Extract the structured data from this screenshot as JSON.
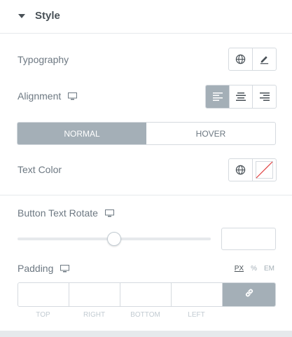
{
  "section": {
    "title": "Style",
    "toggle_icon": "caret-down-icon"
  },
  "typography": {
    "label": "Typography",
    "global_icon": "globe-icon",
    "edit_icon": "pencil-icon"
  },
  "alignment": {
    "label": "Alignment",
    "responsive_icon": "desktop-icon",
    "options": [
      "align-left-icon",
      "align-center-icon",
      "align-right-icon"
    ],
    "selected": "align-left-icon"
  },
  "state_tabs": {
    "items": [
      "NORMAL",
      "HOVER"
    ],
    "active": "NORMAL"
  },
  "text_color": {
    "label": "Text Color",
    "global_icon": "globe-icon",
    "swatch_icon": "no-color-swatch-icon"
  },
  "rotate": {
    "label": "Button Text Rotate",
    "responsive_icon": "desktop-icon",
    "value": "",
    "slider_fraction": 0.5
  },
  "padding": {
    "label": "Padding",
    "responsive_icon": "desktop-icon",
    "units": [
      "PX",
      "%",
      "EM"
    ],
    "active_unit": "PX",
    "sides": [
      "TOP",
      "RIGHT",
      "BOTTOM",
      "LEFT"
    ],
    "values": [
      "",
      "",
      "",
      ""
    ],
    "link_icon": "link-icon"
  },
  "colors": {
    "accent_gray": "#a4afb7",
    "swatch_slash": "#e04040"
  }
}
